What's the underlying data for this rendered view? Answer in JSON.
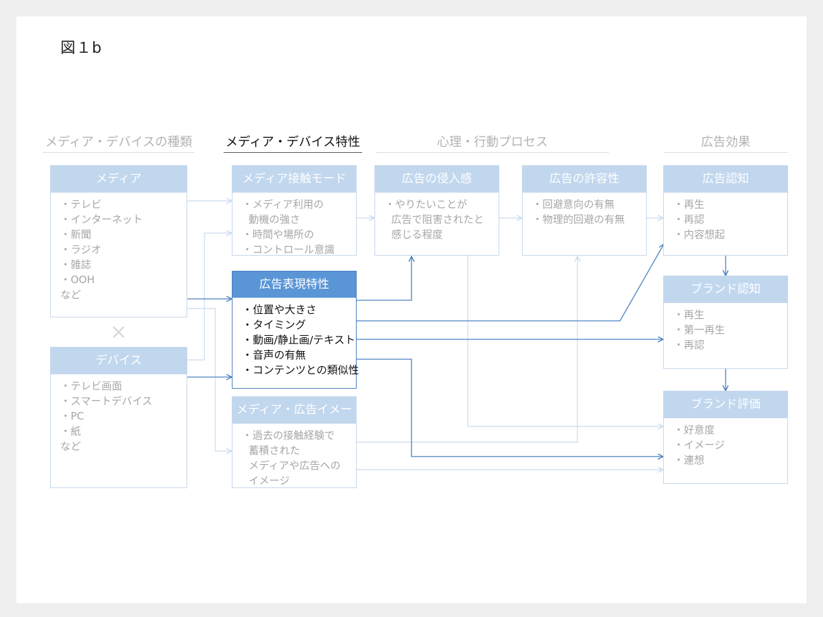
{
  "figure_label": "図１b",
  "columns": [
    {
      "label": "メディア・デバイスの種類"
    },
    {
      "label": "メディア・デバイス特性"
    },
    {
      "label": "心理・行動プロセス"
    },
    {
      "label": "広告効果"
    }
  ],
  "boxes": {
    "media": {
      "title": "メディア",
      "items": [
        "・テレビ",
        "・インターネット",
        "・新聞",
        "・ラジオ",
        "・雑誌",
        "・OOH",
        "など"
      ]
    },
    "device": {
      "title": "デバイス",
      "items": [
        "・テレビ画面",
        "・スマートデバイス",
        "・PC",
        "・紙",
        "など"
      ]
    },
    "contact_mode": {
      "title": "メディア接触モード",
      "items": [
        "・メディア利用の",
        "  動機の強さ",
        "・時間や場所の",
        "・コントロール意識"
      ]
    },
    "expression": {
      "title": "広告表現特性",
      "items": [
        "・位置や大きさ",
        "・タイミング",
        "・動画/静止画/テキスト",
        "・音声の有無",
        "・コンテンツとの類似性"
      ]
    },
    "image": {
      "title": "メディア・広告イメージ",
      "items": [
        "・過去の接触経験で",
        "  蓄積された",
        "  メディアや広告への",
        "  イメージ"
      ]
    },
    "intrusiveness": {
      "title": "広告の侵入感",
      "items": [
        "・やりたいことが",
        "  広告で阻害されたと",
        "  感じる程度"
      ]
    },
    "tolerance": {
      "title": "広告の許容性",
      "items": [
        "・回避意向の有無",
        "・物理的回避の有無"
      ]
    },
    "ad_recognition": {
      "title": "広告認知",
      "items": [
        "・再生",
        "・再認",
        "・内容想起"
      ]
    },
    "brand_recognition": {
      "title": "ブランド認知",
      "items": [
        "・再生",
        "・第一再生",
        "・再認"
      ]
    },
    "brand_evaluation": {
      "title": "ブランド評価",
      "items": [
        "・好意度",
        "・イメージ",
        "・連想"
      ]
    }
  },
  "cross_symbol": "×",
  "colors": {
    "active_header": "#5a95d6",
    "faded_header": "#c1d7ee",
    "active_arrow": "#4a7fc0",
    "faded_arrow": "#c9dbee"
  }
}
